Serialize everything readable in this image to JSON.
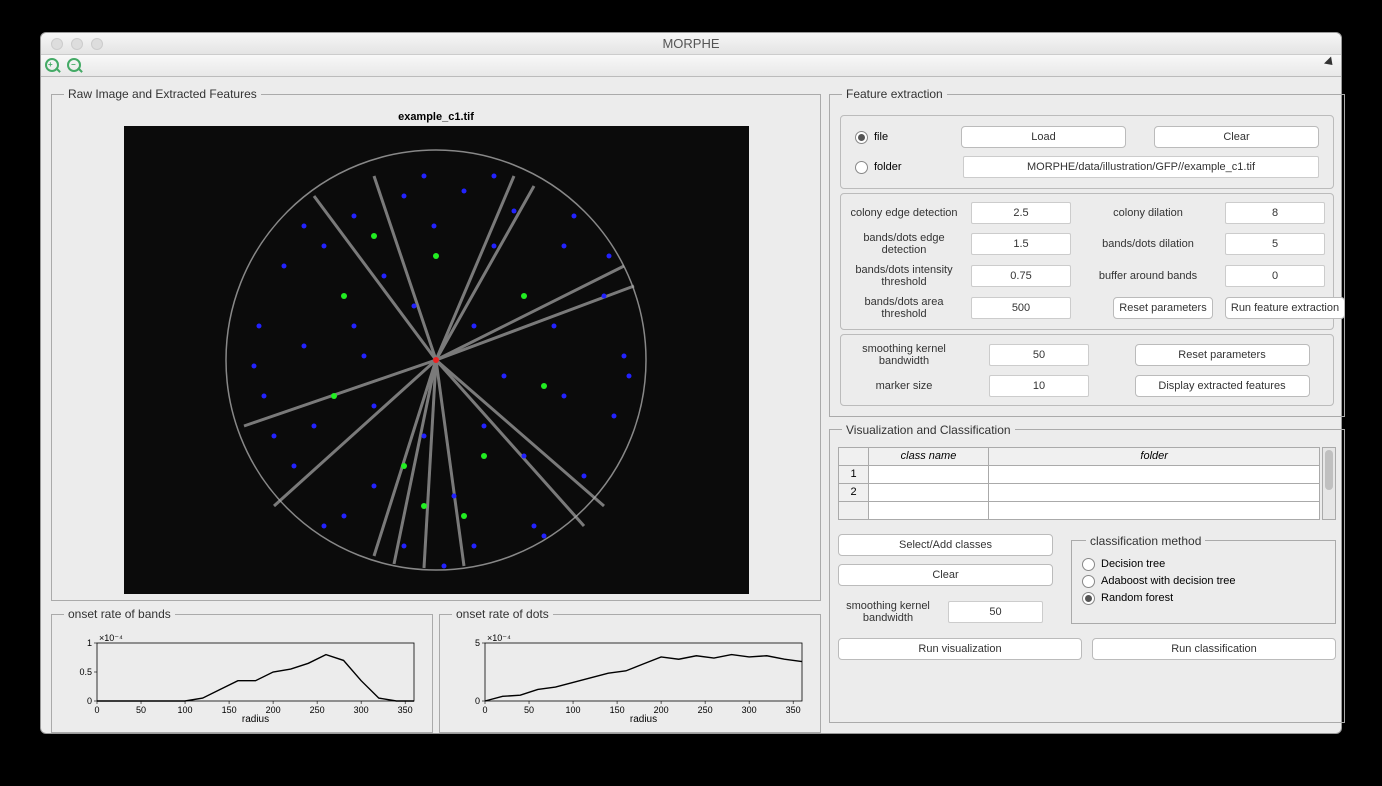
{
  "window": {
    "title": "MORPHE"
  },
  "toolbar": {
    "zoomin_name": "zoom-in-icon",
    "zoomout_name": "zoom-out-icon"
  },
  "left": {
    "legend": "Raw Image and Extracted Features",
    "image_title": "example_c1.tif"
  },
  "charts": {
    "bands": {
      "legend": "onset rate of bands",
      "xlabel": "radius",
      "ylabel_exp": "×10⁻⁴"
    },
    "dots": {
      "legend": "onset rate of dots",
      "xlabel": "radius",
      "ylabel_exp": "×10⁻⁴"
    }
  },
  "chart_data": [
    {
      "type": "line",
      "title": "onset rate of bands",
      "xlabel": "radius",
      "ylabel": "×10⁻⁴",
      "xlim": [
        0,
        360
      ],
      "ylim": [
        0,
        1.0
      ],
      "x": [
        0,
        20,
        40,
        60,
        80,
        100,
        120,
        140,
        160,
        180,
        200,
        220,
        240,
        260,
        280,
        300,
        320,
        340,
        360
      ],
      "values": [
        0,
        0,
        0,
        0,
        0,
        0,
        0.05,
        0.2,
        0.35,
        0.35,
        0.5,
        0.55,
        0.65,
        0.8,
        0.7,
        0.35,
        0.05,
        0,
        0
      ]
    },
    {
      "type": "line",
      "title": "onset rate of dots",
      "xlabel": "radius",
      "ylabel": "×10⁻⁴",
      "xlim": [
        0,
        360
      ],
      "ylim": [
        0,
        5.0
      ],
      "x": [
        0,
        20,
        40,
        60,
        80,
        100,
        120,
        140,
        160,
        180,
        200,
        220,
        240,
        260,
        280,
        300,
        320,
        340,
        360
      ],
      "values": [
        0,
        0.4,
        0.5,
        1.0,
        1.2,
        1.6,
        2.0,
        2.4,
        2.6,
        3.2,
        3.8,
        3.6,
        3.9,
        3.7,
        4.0,
        3.8,
        3.9,
        3.6,
        3.4
      ]
    }
  ],
  "feat": {
    "legend": "Feature extraction",
    "file_label": "file",
    "folder_label": "folder",
    "load_btn": "Load",
    "clear_btn": "Clear",
    "path": "MORPHE/data/illustration/GFP//example_c1.tif",
    "params": {
      "colony_edge_label": "colony edge detection",
      "colony_edge": "2.5",
      "colony_dilation_label": "colony dilation",
      "colony_dilation": "8",
      "bd_edge_label": "bands/dots edge detection",
      "bd_edge": "1.5",
      "bd_dilation_label": "bands/dots dilation",
      "bd_dilation": "5",
      "bd_intensity_label": "bands/dots intensity threshold",
      "bd_intensity": "0.75",
      "buffer_label": "buffer around bands",
      "buffer": "0",
      "bd_area_label": "bands/dots area threshold",
      "bd_area": "500",
      "reset_btn": "Reset parameters",
      "run_btn": "Run feature extraction"
    },
    "display": {
      "kernel_label": "smoothing kernel bandwidth",
      "kernel": "50",
      "marker_label": "marker size",
      "marker": "10",
      "reset_btn": "Reset parameters",
      "disp_btn": "Display extracted features"
    }
  },
  "vis": {
    "legend": "Visualization and Classification",
    "table_headers": {
      "classname": "class name",
      "folder": "folder"
    },
    "table_rows": [
      "1",
      "2",
      ""
    ],
    "select_btn": "Select/Add classes",
    "clear_btn": "Clear",
    "kernel_label": "smoothing kernel bandwidth",
    "kernel": "50",
    "method_legend": "classification method",
    "methods": {
      "dtree": "Decision tree",
      "adaboost": "Adaboost with decision tree",
      "rf": "Random forest"
    },
    "run_vis_btn": "Run visualization",
    "run_class_btn": "Run classification"
  }
}
